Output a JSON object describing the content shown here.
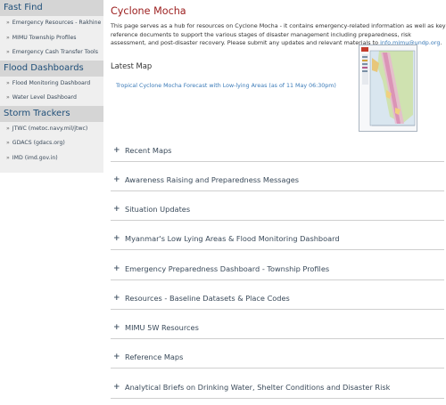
{
  "sidebar": {
    "sections": [
      {
        "heading": "Fast Find",
        "items": [
          {
            "label": "Emergency Resources - Rakhine"
          },
          {
            "label": "MIMU Township Profiles"
          },
          {
            "label": "Emergency Cash Transfer Tools"
          }
        ]
      },
      {
        "heading": "Flood Dashboards",
        "items": [
          {
            "label": "Flood Monitoring Dashboard"
          },
          {
            "label": "Water Level Dashboard"
          }
        ]
      },
      {
        "heading": "Storm Trackers",
        "items": [
          {
            "label": "JTWC (metoc.navy.mil/jtwc)"
          },
          {
            "label": "GDACS (gdacs.org)"
          },
          {
            "label": "IMD (imd.gov.in)"
          }
        ]
      }
    ],
    "bullet": "»"
  },
  "main": {
    "title": "Cyclone Mocha",
    "intro_text": "This page serves as a hub for resources on Cyclone Mocha - it contains emergency-related information as well as key reference documents to support the various stages of disaster management including preparedness, risk assessment, and post-disaster recovery. Please submit any updates and relevant materials to ",
    "intro_email": "info.mimu@undp.org",
    "intro_end": ".",
    "latest_map_heading": "Latest Map",
    "latest_map_link": "Tropical Cyclone Mocha Forecast with Low-lying Areas (as of 11 May 06:30pm)",
    "accordion_symbol": "+",
    "accordion": [
      {
        "label": "Recent Maps"
      },
      {
        "label": "Awareness Raising and Preparedness Messages"
      },
      {
        "label": "Situation Updates"
      },
      {
        "label": "Myanmar's Low Lying Areas & Flood Monitoring Dashboard"
      },
      {
        "label": "Emergency Preparedness Dashboard - Township Profiles"
      },
      {
        "label": "Resources - Baseline Datasets & Place Codes"
      },
      {
        "label": "MIMU 5W Resources"
      },
      {
        "label": "Reference Maps"
      },
      {
        "label": "Analytical Briefs on Drinking Water, Shelter Conditions and Disaster Risk"
      }
    ]
  },
  "colors": {
    "title": "#9b1c1c",
    "link": "#3b7bb8",
    "sidebar_heading": "#1f4f79",
    "sidebar_heading_bg": "#d5d5d5",
    "sidebar_bg": "#efefef"
  }
}
